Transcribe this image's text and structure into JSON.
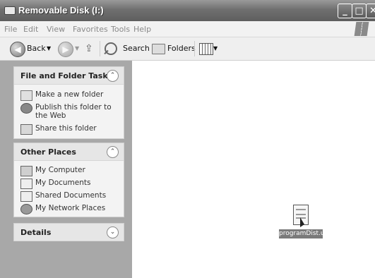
{
  "window": {
    "title": "Removable Disk (I:)"
  },
  "menubar": {
    "items": [
      "File",
      "Edit",
      "View",
      "Favorites",
      "Tools",
      "Help"
    ]
  },
  "toolbar": {
    "back_label": "Back",
    "search_label": "Search",
    "folders_label": "Folders"
  },
  "panels": {
    "file_tasks": {
      "title": "File and Folder Tasks",
      "items": [
        "Make a new folder",
        "Publish this folder to the Web",
        "Share this folder"
      ]
    },
    "other_places": {
      "title": "Other Places",
      "items": [
        "My Computer",
        "My Documents",
        "Shared Documents",
        "My Network Places"
      ]
    },
    "details": {
      "title": "Details"
    }
  },
  "files": [
    {
      "name": "programDist.upg",
      "icon": "document-icon",
      "selected": true
    }
  ]
}
